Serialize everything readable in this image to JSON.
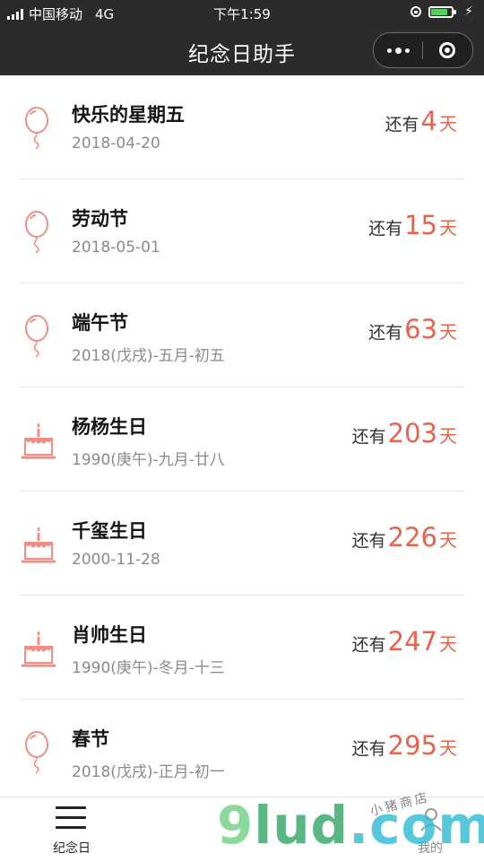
{
  "status_bar": {
    "carrier": "中国移动",
    "network": "4G",
    "time": "下午1:59"
  },
  "nav": {
    "title": "纪念日助手"
  },
  "events": [
    {
      "name": "快乐的星期五",
      "date": "2018-04-20",
      "prefix": "还有",
      "days": "4",
      "unit": "天",
      "icon": "balloon-icon"
    },
    {
      "name": "劳动节",
      "date": "2018-05-01",
      "prefix": "还有",
      "days": "15",
      "unit": "天",
      "icon": "balloon-icon"
    },
    {
      "name": "端午节",
      "date": "2018(戊戌)-五月-初五",
      "prefix": "还有",
      "days": "63",
      "unit": "天",
      "icon": "balloon-icon"
    },
    {
      "name": "杨杨生日",
      "date": "1990(庚午)-九月-廿八",
      "prefix": "还有",
      "days": "203",
      "unit": "天",
      "icon": "cake-icon"
    },
    {
      "name": "千玺生日",
      "date": "2000-11-28",
      "prefix": "还有",
      "days": "226",
      "unit": "天",
      "icon": "cake-icon"
    },
    {
      "name": "肖帅生日",
      "date": "1990(庚午)-冬月-十三",
      "prefix": "还有",
      "days": "247",
      "unit": "天",
      "icon": "cake-icon"
    },
    {
      "name": "春节",
      "date": "2018(戊戌)-正月-初一",
      "prefix": "还有",
      "days": "295",
      "unit": "天",
      "icon": "balloon-icon"
    }
  ],
  "tabbar": {
    "tab1_label": "纪念日",
    "tab2_label": "我的"
  },
  "watermark": {
    "main": "9lud.com",
    "small": "小猪商店"
  },
  "colors": {
    "accent": "#e8624c",
    "navbar": "#2b2b2b",
    "icon": "#ef8e86"
  }
}
